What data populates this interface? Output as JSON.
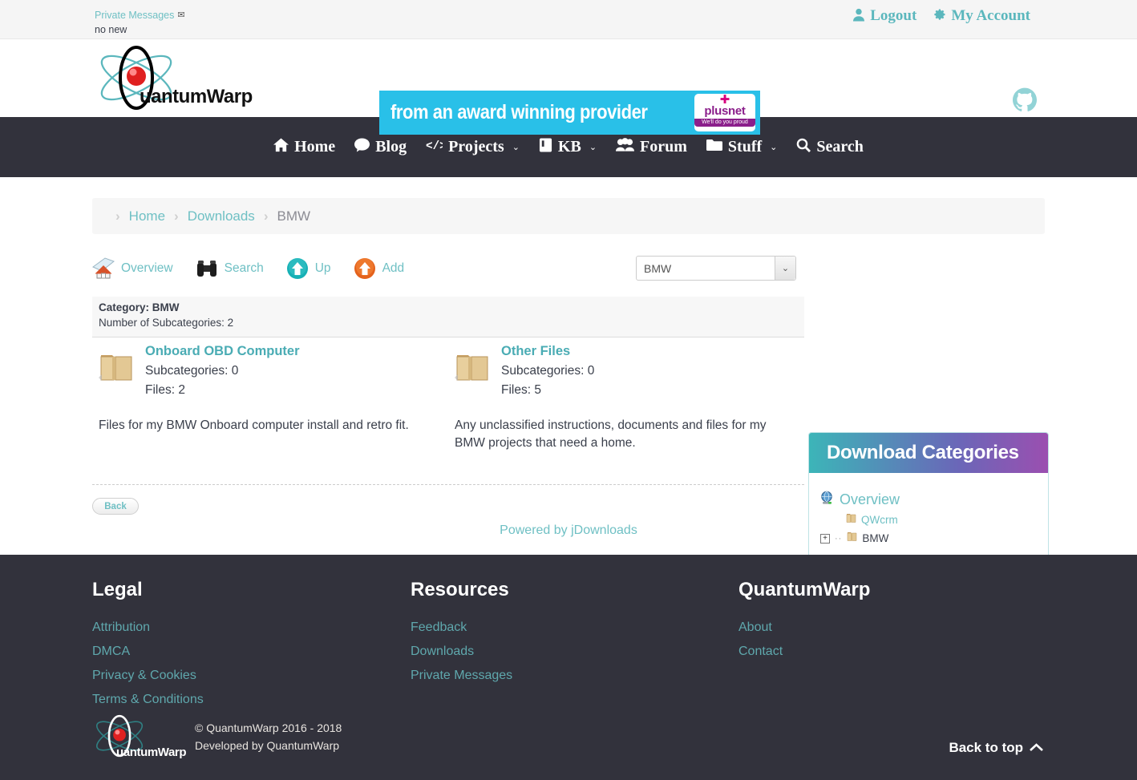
{
  "topbar": {
    "private_messages_label": "Private Messages",
    "private_messages_icon": "envelope-icon",
    "no_new_label": "no new",
    "logout_label": "Logout",
    "my_account_label": "My Account"
  },
  "header": {
    "logo_text": "uantumWarp",
    "banner_text": "from an award winning provider",
    "banner_bg": "#29c0e8",
    "plusnet_name": "plusnet",
    "plusnet_tagline": "We'll do you proud",
    "github_icon": "github-icon"
  },
  "nav": {
    "items": [
      {
        "label": "Home",
        "icon": "home-icon",
        "caret": ""
      },
      {
        "label": "Blog",
        "icon": "comment-icon",
        "caret": ""
      },
      {
        "label": "Projects",
        "icon": "code-icon",
        "caret": "⌄"
      },
      {
        "label": "KB",
        "icon": "book-icon",
        "caret": "⌄"
      },
      {
        "label": "Forum",
        "icon": "users-icon",
        "caret": ""
      },
      {
        "label": "Stuff",
        "icon": "folder-icon",
        "caret": "⌄"
      },
      {
        "label": "Search",
        "icon": "search-icon",
        "caret": ""
      }
    ]
  },
  "breadcrumb": {
    "items": [
      "Home",
      "Downloads",
      "BMW"
    ],
    "separator": "›"
  },
  "toolbar": {
    "overview_label": "Overview",
    "search_label": "Search",
    "up_label": "Up",
    "add_label": "Add",
    "category_select_value": "BMW",
    "select_arrow": "⌄"
  },
  "category": {
    "label_prefix": "Category:",
    "name": "BMW",
    "subcategories_line": "Number of Subcategories: 2"
  },
  "subcategories": [
    {
      "title": "Onboard OBD Computer",
      "subcategories": "Subcategories: 0",
      "files": "Files: 2",
      "description": "Files for my BMW Onboard computer install and retro fit."
    },
    {
      "title": "Other Files",
      "subcategories": "Subcategories: 0",
      "files": "Files: 5",
      "description": "Any unclassified instructions, documents and files for my BMW projects that need a home."
    }
  ],
  "sidebar": {
    "title": "Download Categories",
    "overview_label": "Overview",
    "tree": [
      {
        "label": "QWcrm",
        "expander": "",
        "current": false
      },
      {
        "label": "BMW",
        "expander": "+",
        "current": true
      }
    ]
  },
  "content_footer": {
    "back_label": "Back",
    "powered_label": "Powered by jDownloads"
  },
  "footer": {
    "columns": [
      {
        "title": "Legal",
        "links": [
          "Attribution",
          "DMCA",
          "Privacy & Cookies",
          "Terms & Conditions"
        ]
      },
      {
        "title": "Resources",
        "links": [
          "Feedback",
          "Downloads",
          "Private Messages"
        ]
      },
      {
        "title": "QuantumWarp",
        "links": [
          "About",
          "Contact"
        ]
      }
    ],
    "logo_text": "uantumWarp",
    "copyright": "© QuantumWarp 2016 - 2018",
    "developed_by": "Developed by QuantumWarp",
    "back_to_top": "Back to top"
  },
  "colors": {
    "accent_teal": "#6fc0c4",
    "dark": "#32323c",
    "link_teal": "#4aacb4",
    "footer_link": "#5fa8ad"
  }
}
